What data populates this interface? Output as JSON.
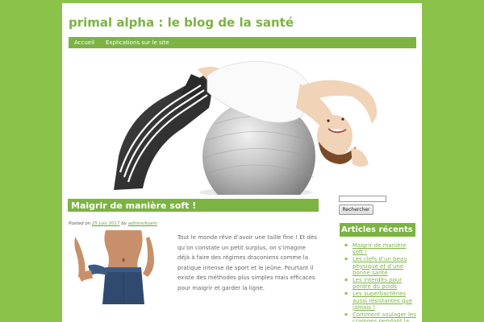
{
  "site": {
    "title": "primal alpha : le blog de la santé"
  },
  "nav": {
    "items": [
      "Accueil",
      "Explications sur le site"
    ]
  },
  "colors": {
    "background": "#8bc34a",
    "accent": "#7cb342",
    "link": "#7cb342"
  },
  "post": {
    "title": "Maigrir de manière soft !",
    "meta": {
      "posted_on": "Posted on",
      "date": "25 juin 2017",
      "by": "by",
      "author": "adminvfuaim"
    },
    "body": "Tout le monde rêve d’avoir une taille fine ! Et dès qu’on constate un petit surplus, on s’imagine déjà à faire des régimes draconiens comme la pratique intense de sport et le jeûne. Pourtant il existe des méthodes plus simples mais efficaces pour maigrir et garder la ligne."
  },
  "sidebar": {
    "search_button": "Rechercher",
    "recent_title": "Articles récents",
    "recent_posts": [
      "Maigrir de manière soft !",
      "Les clefs d’un beau physique et d’une bonne santé",
      "Les interdits pour perdre du poids",
      "Les superbactéries aussi résistantes que jamais !",
      "Comment soulager les crampes pendant la grossesse ?"
    ]
  }
}
